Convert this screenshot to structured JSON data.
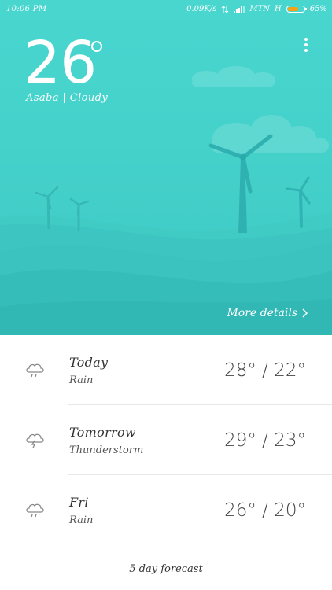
{
  "status_bar": {
    "time": "10:06 PM",
    "network_speed": "0.09K/s",
    "carrier": "MTN",
    "network_type": "H",
    "battery_percent": "65%",
    "battery_level": 0.65,
    "battery_color": "#f3a315"
  },
  "current": {
    "temperature": "26",
    "location_condition": "Asaba | Cloudy"
  },
  "hero": {
    "more_details_label": "More details",
    "background_color": "#45d2cb"
  },
  "forecast": [
    {
      "day": "Today",
      "condition": "Rain",
      "range": "28° / 22°",
      "icon": "rain-cloud-icon"
    },
    {
      "day": "Tomorrow",
      "condition": "Thunderstorm",
      "range": "29° / 23°",
      "icon": "thunderstorm-cloud-icon"
    },
    {
      "day": "Fri",
      "condition": "Rain",
      "range": "26° / 20°",
      "icon": "rain-cloud-icon"
    }
  ],
  "footer": {
    "five_day_label": "5 day forecast"
  }
}
